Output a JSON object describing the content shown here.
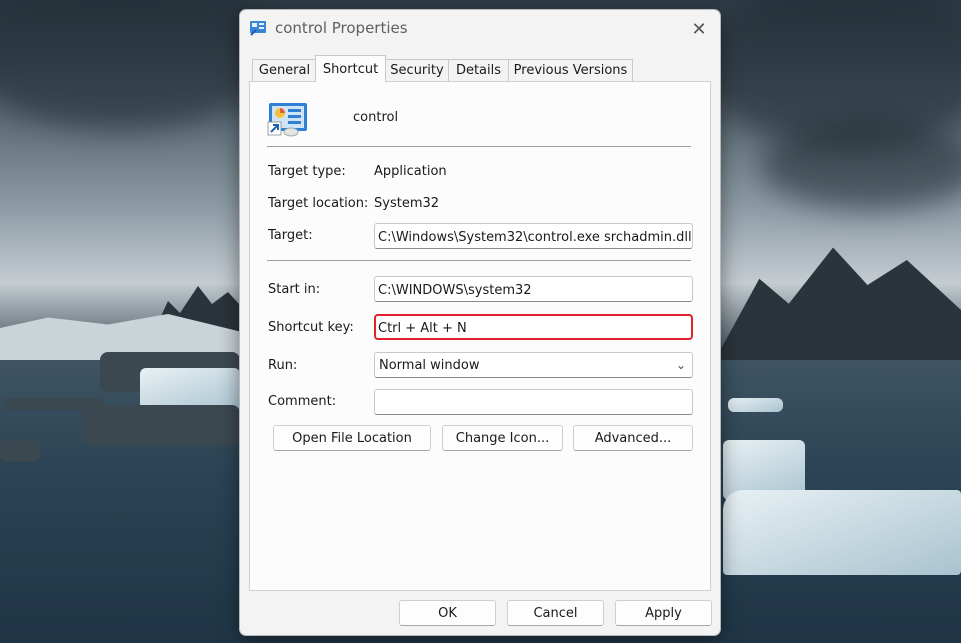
{
  "window": {
    "title": "control Properties",
    "close_label": "✕"
  },
  "tabs": [
    {
      "label": "General",
      "active": false
    },
    {
      "label": "Shortcut",
      "active": true
    },
    {
      "label": "Security",
      "active": false
    },
    {
      "label": "Details",
      "active": false
    },
    {
      "label": "Previous Versions",
      "active": false
    }
  ],
  "shortcut": {
    "app_name": "control",
    "target_type_label": "Target type:",
    "target_type_value": "Application",
    "target_location_label": "Target location:",
    "target_location_value": "System32",
    "target_label": "Target:",
    "target_value": "C:\\Windows\\System32\\control.exe srchadmin.dll",
    "start_in_label": "Start in:",
    "start_in_value": "C:\\WINDOWS\\system32",
    "shortcut_key_label": "Shortcut key:",
    "shortcut_key_value": "Ctrl + Alt + N",
    "run_label": "Run:",
    "run_value": "Normal window",
    "comment_label": "Comment:",
    "comment_value": "",
    "open_file_location": "Open File Location",
    "change_icon": "Change Icon...",
    "advanced": "Advanced..."
  },
  "footer": {
    "ok": "OK",
    "cancel": "Cancel",
    "apply": "Apply"
  },
  "colors": {
    "highlight": "#e0202a",
    "dialog_bg": "#f3f3f3"
  }
}
